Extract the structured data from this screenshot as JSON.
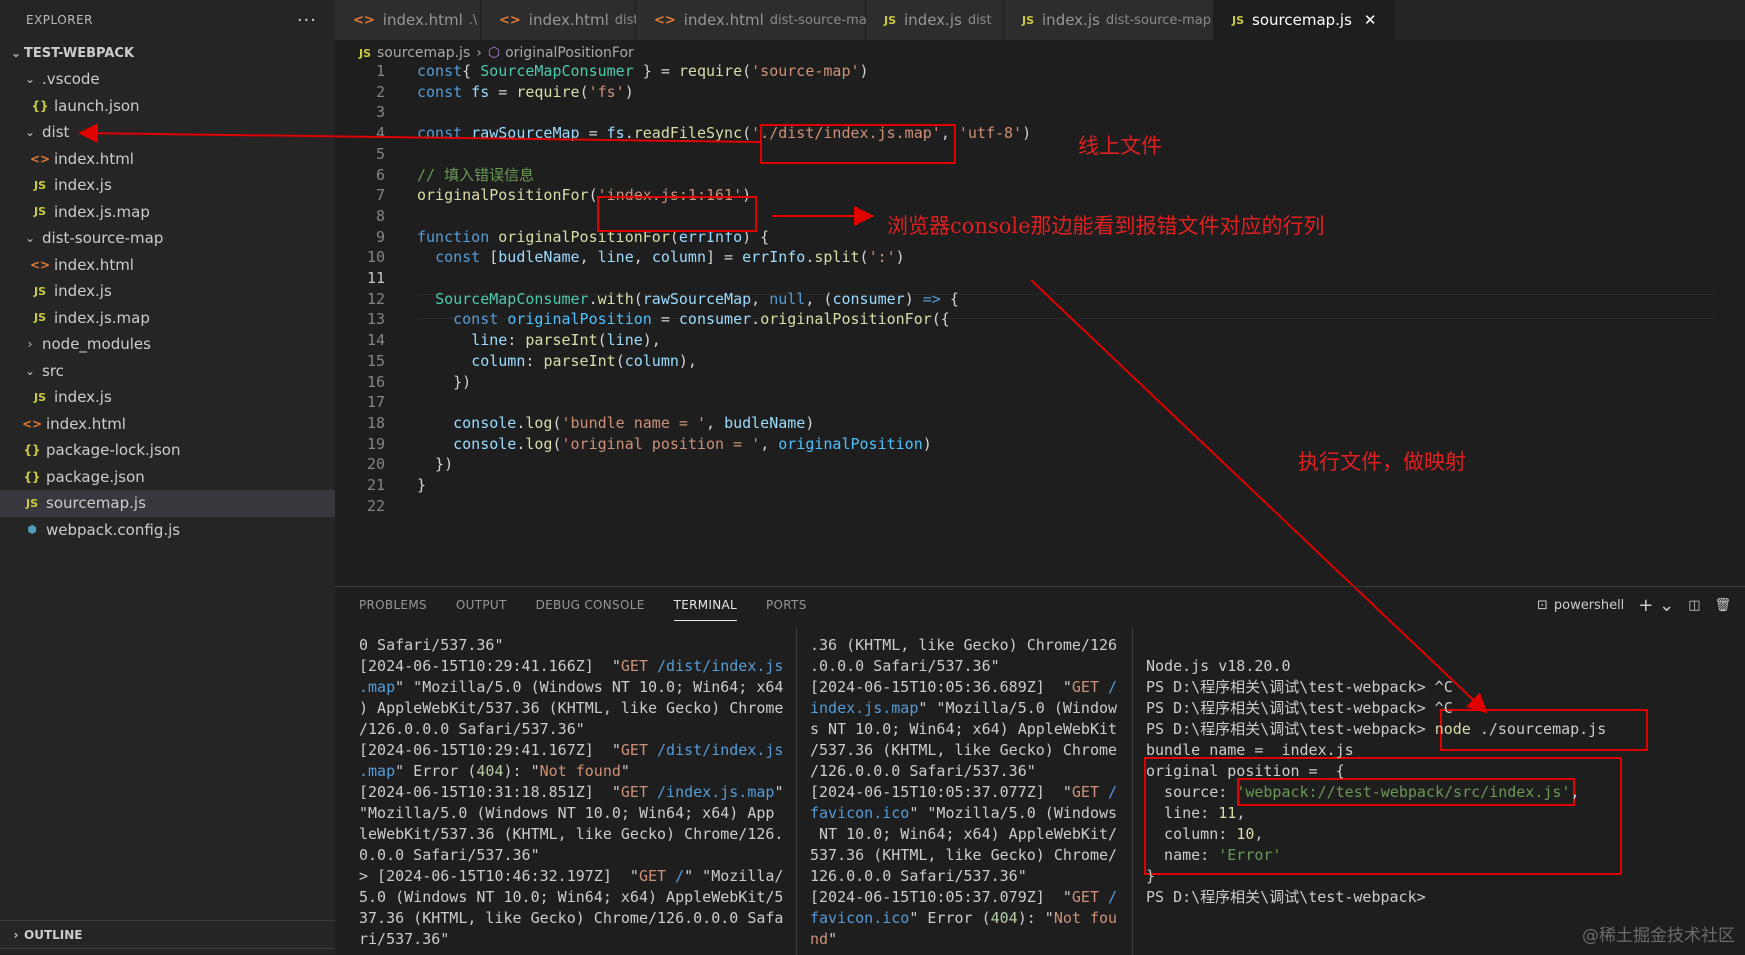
{
  "sidebar": {
    "title": "EXPLORER",
    "more_glyph": "···",
    "project": "TEST-WEBPACK",
    "items": [
      {
        "label": ".vscode",
        "type": "folder-open",
        "indent": 1
      },
      {
        "label": "launch.json",
        "type": "json",
        "indent": 2
      },
      {
        "label": "dist",
        "type": "folder-open",
        "indent": 1
      },
      {
        "label": "index.html",
        "type": "html",
        "indent": 2
      },
      {
        "label": "index.js",
        "type": "js",
        "indent": 2
      },
      {
        "label": "index.js.map",
        "type": "js",
        "indent": 2
      },
      {
        "label": "dist-source-map",
        "type": "folder-open",
        "indent": 1
      },
      {
        "label": "index.html",
        "type": "html",
        "indent": 2
      },
      {
        "label": "index.js",
        "type": "js",
        "indent": 2
      },
      {
        "label": "index.js.map",
        "type": "js",
        "indent": 2
      },
      {
        "label": "node_modules",
        "type": "folder-closed",
        "indent": 1
      },
      {
        "label": "src",
        "type": "folder-open",
        "indent": 1
      },
      {
        "label": "index.js",
        "type": "js",
        "indent": 2
      },
      {
        "label": "index.html",
        "type": "html",
        "indent": 1
      },
      {
        "label": "package-lock.json",
        "type": "json",
        "indent": 1
      },
      {
        "label": "package.json",
        "type": "json",
        "indent": 1
      },
      {
        "label": "sourcemap.js",
        "type": "js",
        "indent": 1,
        "active": true
      },
      {
        "label": "webpack.config.js",
        "type": "cfg",
        "indent": 1
      }
    ],
    "outline": "OUTLINE"
  },
  "tabs": [
    {
      "label": "index.html",
      "desc": ".\\",
      "icon": "html"
    },
    {
      "label": "index.html",
      "desc": "dist",
      "icon": "html"
    },
    {
      "label": "index.html",
      "desc": "dist-source-map",
      "icon": "html"
    },
    {
      "label": "index.js",
      "desc": "dist",
      "icon": "js"
    },
    {
      "label": "index.js",
      "desc": "dist-source-map",
      "icon": "js"
    },
    {
      "label": "sourcemap.js",
      "desc": "",
      "icon": "js",
      "active": true
    }
  ],
  "breadcrumb": {
    "file": "sourcemap.js",
    "symbol": "originalPositionFor"
  },
  "editor": {
    "current_line": 11,
    "lines": [
      [
        [
          "kw",
          "const"
        ],
        [
          "",
          "{ "
        ],
        [
          "cls",
          "SourceMapConsumer"
        ],
        [
          "",
          " } = "
        ],
        [
          "fn",
          "require"
        ],
        [
          "",
          "("
        ],
        [
          "str",
          "'source-map'"
        ],
        [
          "",
          ")"
        ]
      ],
      [
        [
          "kw",
          "const"
        ],
        [
          "",
          ""
        ],
        [
          "var",
          " fs"
        ],
        [
          "",
          " = "
        ],
        [
          "fn",
          "require"
        ],
        [
          "",
          "("
        ],
        [
          "str",
          "'fs'"
        ],
        [
          "",
          ")"
        ]
      ],
      [],
      [
        [
          "kw",
          "const"
        ],
        [
          "var",
          " rawSourceMap"
        ],
        [
          "",
          " = "
        ],
        [
          "var",
          "fs"
        ],
        [
          "",
          "."
        ],
        [
          "fn",
          "readFileSync"
        ],
        [
          "",
          "("
        ],
        [
          "str",
          "'./dist/index.js.map'"
        ],
        [
          "",
          ", "
        ],
        [
          "str",
          "'utf-8'"
        ],
        [
          "",
          ")"
        ]
      ],
      [],
      [
        [
          "cm",
          "// 填入错误信息"
        ]
      ],
      [
        [
          "fn",
          "originalPositionFor"
        ],
        [
          "",
          "("
        ],
        [
          "str",
          "'index.js:1:161'"
        ],
        [
          "",
          ")"
        ]
      ],
      [],
      [
        [
          "kw",
          "function"
        ],
        [
          "",
          " "
        ],
        [
          "fn",
          "originalPositionFor"
        ],
        [
          "",
          "("
        ],
        [
          "var",
          "errInfo"
        ],
        [
          "",
          ") {"
        ]
      ],
      [
        [
          "",
          "  "
        ],
        [
          "kw",
          "const"
        ],
        [
          "",
          " ["
        ],
        [
          "var",
          "budleName"
        ],
        [
          "",
          ", "
        ],
        [
          "var",
          "line"
        ],
        [
          "",
          ", "
        ],
        [
          "var",
          "column"
        ],
        [
          "",
          "] = "
        ],
        [
          "var",
          "errInfo"
        ],
        [
          "",
          "."
        ],
        [
          "fn",
          "split"
        ],
        [
          "",
          "("
        ],
        [
          "str",
          "':'"
        ],
        [
          "",
          ")"
        ]
      ],
      [],
      [
        [
          "",
          "  "
        ],
        [
          "cls",
          "SourceMapConsumer"
        ],
        [
          "",
          "."
        ],
        [
          "fn",
          "with"
        ],
        [
          "",
          "("
        ],
        [
          "var",
          "rawSourceMap"
        ],
        [
          "",
          ", "
        ],
        [
          "kw",
          "null"
        ],
        [
          "",
          ", ("
        ],
        [
          "var",
          "consumer"
        ],
        [
          "",
          ") "
        ],
        [
          "kw",
          "=>"
        ],
        [
          "",
          " {"
        ]
      ],
      [
        [
          "",
          "    "
        ],
        [
          "kw",
          "const"
        ],
        [
          "",
          " "
        ],
        [
          "cst",
          "originalPosition"
        ],
        [
          "",
          " = "
        ],
        [
          "var",
          "consumer"
        ],
        [
          "",
          "."
        ],
        [
          "fn",
          "originalPositionFor"
        ],
        [
          "",
          "({"
        ]
      ],
      [
        [
          "",
          "      "
        ],
        [
          "var",
          "line"
        ],
        [
          "",
          ": "
        ],
        [
          "fn",
          "parseInt"
        ],
        [
          "",
          "("
        ],
        [
          "var",
          "line"
        ],
        [
          "",
          "),"
        ]
      ],
      [
        [
          "",
          "      "
        ],
        [
          "var",
          "column"
        ],
        [
          "",
          ": "
        ],
        [
          "fn",
          "parseInt"
        ],
        [
          "",
          "("
        ],
        [
          "var",
          "column"
        ],
        [
          "",
          "),"
        ]
      ],
      [
        [
          "",
          "    })"
        ]
      ],
      [],
      [
        [
          "",
          "    "
        ],
        [
          "var",
          "console"
        ],
        [
          "",
          "."
        ],
        [
          "fn",
          "log"
        ],
        [
          "",
          "("
        ],
        [
          "str",
          "'bundle name = '"
        ],
        [
          "",
          ", "
        ],
        [
          "var",
          "budleName"
        ],
        [
          "",
          ")"
        ]
      ],
      [
        [
          "",
          "    "
        ],
        [
          "var",
          "console"
        ],
        [
          "",
          "."
        ],
        [
          "fn",
          "log"
        ],
        [
          "",
          "("
        ],
        [
          "str",
          "'original position = '"
        ],
        [
          "",
          ", "
        ],
        [
          "cst",
          "originalPosition"
        ],
        [
          "",
          ")"
        ]
      ],
      [
        [
          "",
          "  })"
        ]
      ],
      [
        [
          "",
          "}"
        ]
      ],
      []
    ]
  },
  "annotations": {
    "online_file": "线上文件",
    "console_hint": "浏览器console那边能看到报错文件对应的行列",
    "run_hint": "执行文件，做映射"
  },
  "panel": {
    "tabs": [
      "PROBLEMS",
      "OUTPUT",
      "DEBUG CONSOLE",
      "TERMINAL",
      "PORTS"
    ],
    "active_tab": "TERMINAL",
    "shell": "powershell",
    "terminal_left": [
      [
        [
          "",
          "0 Safari/537.36\""
        ]
      ],
      [
        [
          "",
          "[2024-06-15T10:29:41.166Z]  \""
        ],
        [
          "tstr",
          "GET "
        ],
        [
          "tpath",
          "/dist/index.js"
        ]
      ],
      [
        [
          "tpath",
          ".map"
        ],
        [
          "",
          "\" \"Mozilla/5.0 (Windows NT 10.0; Win64; x64"
        ]
      ],
      [
        [
          "",
          ") AppleWebKit/537.36 (KHTML, like Gecko) Chrome"
        ]
      ],
      [
        [
          "",
          "/126.0.0.0 Safari/537.36\""
        ]
      ],
      [
        [
          "",
          "[2024-06-15T10:29:41.167Z]  \""
        ],
        [
          "tstr",
          "GET "
        ],
        [
          "tpath",
          "/dist/index.js"
        ]
      ],
      [
        [
          "tpath",
          ".map"
        ],
        [
          "",
          "\" Error ("
        ],
        [
          "tnum",
          "404"
        ],
        [
          "",
          "): \""
        ],
        [
          "tstr",
          "Not found"
        ],
        [
          "",
          "\""
        ]
      ],
      [
        [
          "",
          "[2024-06-15T10:31:18.851Z]  \""
        ],
        [
          "tstr",
          "GET "
        ],
        [
          "tpath",
          "/index.js.map"
        ],
        [
          "",
          "\""
        ]
      ],
      [
        [
          "",
          ""
        ],
        [
          "",
          "\"Mozilla/5.0 (Windows NT 10.0; Win64; x64) App"
        ]
      ],
      [
        [
          "",
          "leWebKit/537.36 (KHTML, like Gecko) Chrome/126."
        ]
      ],
      [
        [
          "",
          "0.0.0 Safari/537.36\""
        ]
      ],
      [
        [
          "",
          "> [2024-06-15T10:46:32.197Z]  \""
        ],
        [
          "tstr",
          "GET "
        ],
        [
          "tpath",
          "/"
        ],
        [
          "",
          "\" \"Mozilla/"
        ]
      ],
      [
        [
          "",
          "5.0 (Windows NT 10.0; Win64; x64) AppleWebKit/5"
        ]
      ],
      [
        [
          "",
          "37.36 (KHTML, like Gecko) Chrome/126.0.0.0 Safa"
        ]
      ],
      [
        [
          "",
          "ri/537.36\""
        ]
      ]
    ],
    "terminal_mid": [
      [
        [
          "",
          ".36 (KHTML, like Gecko) Chrome/126"
        ]
      ],
      [
        [
          "",
          ".0.0.0 Safari/537.36\""
        ]
      ],
      [
        [
          "",
          "[2024-06-15T10:05:36.689Z]  \""
        ],
        [
          "tstr",
          "GET "
        ],
        [
          "tpath",
          "/"
        ]
      ],
      [
        [
          "tpath",
          "index.js.map"
        ],
        [
          "",
          "\" \"Mozilla/5.0 (Window"
        ]
      ],
      [
        [
          "",
          "s NT 10.0; Win64; x64) AppleWebKit"
        ]
      ],
      [
        [
          "",
          "/537.36 (KHTML, like Gecko) Chrome"
        ]
      ],
      [
        [
          "",
          "/126.0.0.0 Safari/537.36\""
        ]
      ],
      [
        [
          "",
          "[2024-06-15T10:05:37.077Z]  \""
        ],
        [
          "tstr",
          "GET "
        ],
        [
          "tpath",
          "/"
        ]
      ],
      [
        [
          "tpath",
          "favicon.ico"
        ],
        [
          "",
          "\" \"Mozilla/5.0 (Windows"
        ]
      ],
      [
        [
          "",
          " NT 10.0; Win64; x64) AppleWebKit/"
        ]
      ],
      [
        [
          "",
          "537.36 (KHTML, like Gecko) Chrome/"
        ]
      ],
      [
        [
          "",
          "126.0.0.0 Safari/537.36\""
        ]
      ],
      [
        [
          "",
          "[2024-06-15T10:05:37.079Z]  \""
        ],
        [
          "tstr",
          "GET "
        ],
        [
          "tpath",
          "/"
        ]
      ],
      [
        [
          "tpath",
          "favicon.ico"
        ],
        [
          "",
          "\" Error ("
        ],
        [
          "tnum",
          "404"
        ],
        [
          "",
          "): \""
        ],
        [
          "tstr",
          "Not fou"
        ]
      ],
      [
        [
          "tstr",
          "nd"
        ],
        [
          "",
          "\""
        ]
      ]
    ],
    "terminal_right": [
      [
        [
          "",
          ""
        ]
      ],
      [
        [
          "",
          "Node.js v18.20.0"
        ]
      ],
      [
        [
          "",
          "PS D:\\程序相关\\调试\\test-webpack> ^C"
        ]
      ],
      [
        [
          "",
          "PS D:\\程序相关\\调试\\test-webpack> ^C"
        ]
      ],
      [
        [
          "",
          "PS D:\\程序相关\\调试\\test-webpack> "
        ],
        [
          "tyellow",
          "node"
        ],
        [
          "",
          " ./sourcemap.js"
        ]
      ],
      [
        [
          "",
          "bundle name =  index.js"
        ]
      ],
      [
        [
          "",
          "original position =  {"
        ]
      ],
      [
        [
          "",
          "  source: "
        ],
        [
          "tgreen",
          "'webpack://test-webpack/src/index.js'"
        ],
        [
          "",
          ","
        ]
      ],
      [
        [
          "",
          "  line: "
        ],
        [
          "tyellow",
          "11"
        ],
        [
          "",
          ","
        ]
      ],
      [
        [
          "",
          "  column: "
        ],
        [
          "tyellow",
          "10"
        ],
        [
          "",
          ","
        ]
      ],
      [
        [
          "",
          "  name: "
        ],
        [
          "tgreen",
          "'Error'"
        ]
      ],
      [
        [
          "",
          "}"
        ]
      ],
      [
        [
          "",
          "PS D:\\程序相关\\调试\\test-webpack> "
        ]
      ]
    ]
  },
  "watermark": "@稀土掘金技术社区"
}
